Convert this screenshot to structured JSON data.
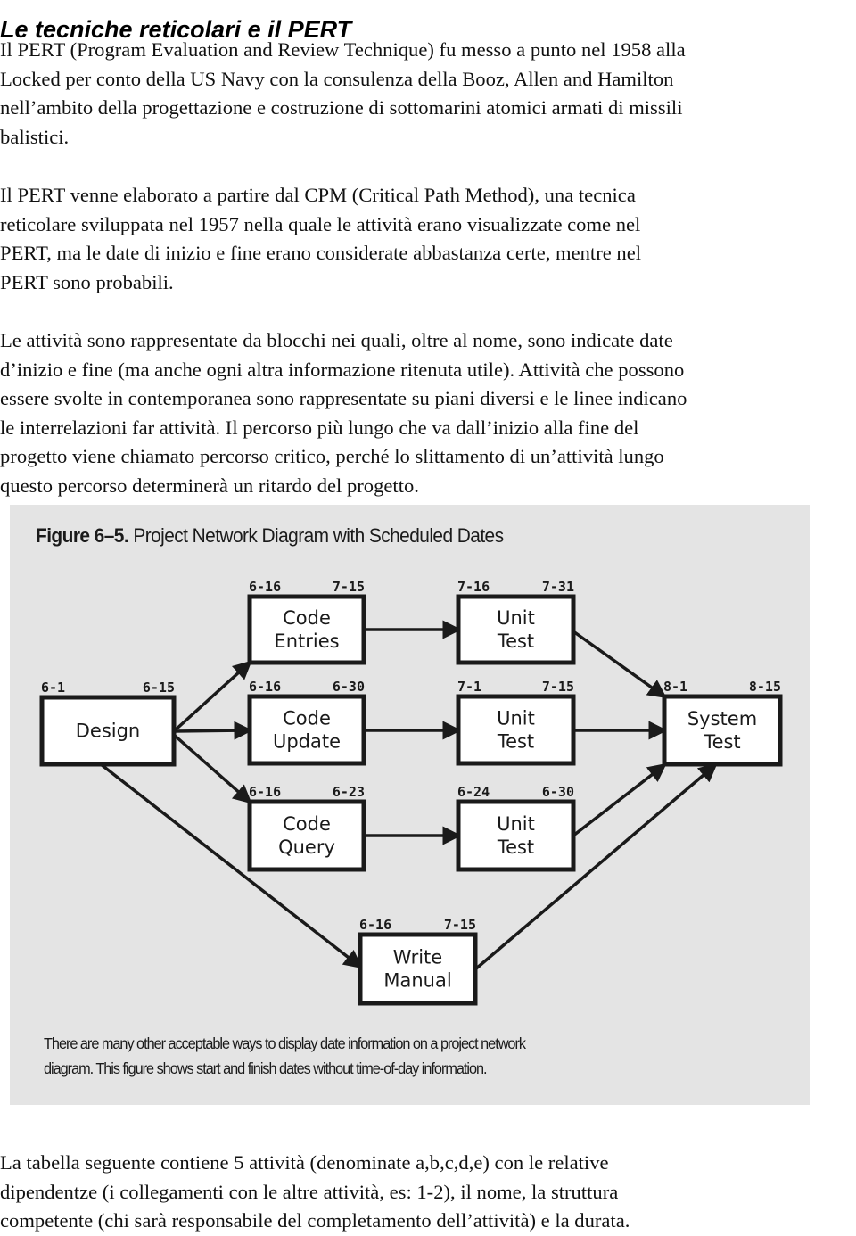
{
  "page": {
    "title": "Le tecniche reticolari e il PERT",
    "paragraphs": [
      {
        "lines": [
          "Il PERT (Program Evaluation and Review Technique) fu messo a punto nel 1958 alla",
          "Locked per conto della US Navy con la consulenza della Booz, Allen and Hamilton",
          "nell’ambito della progettazione e costruzione di sottomarini atomici armati di missili",
          "balistici."
        ]
      },
      {
        "lines": [
          "Il PERT venne elaborato a partire dal CPM (Critical Path Method), una tecnica",
          "reticolare sviluppata nel 1957 nella quale le attività erano visualizzate come nel",
          "PERT, ma le date di inizio e fine erano considerate abbastanza certe, mentre nel",
          "PERT sono probabili."
        ]
      },
      {
        "lines": [
          "Le attività sono rappresentate da blocchi nei quali, oltre al nome, sono indicate date",
          "d’inizio e fine (ma anche ogni altra informazione ritenuta utile). Attività che possono",
          "essere svolte in contemporanea sono rappresentate su piani diversi e le linee indicano",
          "le interrelazioni far attività. Il percorso più lungo che va dall’inizio alla fine del",
          "progetto viene chiamato percorso critico, perché lo slittamento di un’attività lungo",
          "questo percorso determinerà un ritardo del progetto."
        ]
      },
      {
        "lines": [
          "La tabella seguente contiene 5 attività (denominate a,b,c,d,e) con le relative",
          "dipendentze (i collegamenti con le altre attività, es: 1-2), il nome, la struttura",
          "competente (chi sarà responsabile del completamento dell’attività) e la durata."
        ]
      }
    ]
  },
  "figure": {
    "title_prefix": "Figure 6–5.",
    "title_text": " Project Network Diagram with Scheduled Dates",
    "caption_lines": [
      "There are many other acceptable ways to display date information on a project network",
      "diagram. This figure shows start and finish dates without time-of-day information."
    ],
    "nodes": [
      {
        "id": "design",
        "lines": [
          "Design"
        ],
        "start": "6-1",
        "finish": "6-15"
      },
      {
        "id": "code-entries",
        "lines": [
          "Code",
          "Entries"
        ],
        "start": "6-16",
        "finish": "7-15"
      },
      {
        "id": "code-update",
        "lines": [
          "Code",
          "Update"
        ],
        "start": "6-16",
        "finish": "6-30"
      },
      {
        "id": "code-query",
        "lines": [
          "Code",
          "Query"
        ],
        "start": "6-16",
        "finish": "6-23"
      },
      {
        "id": "unit-test-1",
        "lines": [
          "Unit",
          "Test"
        ],
        "start": "7-16",
        "finish": "7-31"
      },
      {
        "id": "unit-test-2",
        "lines": [
          "Unit",
          "Test"
        ],
        "start": "7-1",
        "finish": "7-15"
      },
      {
        "id": "unit-test-3",
        "lines": [
          "Unit",
          "Test"
        ],
        "start": "6-24",
        "finish": "6-30"
      },
      {
        "id": "system-test",
        "lines": [
          "System",
          "Test"
        ],
        "start": "8-1",
        "finish": "8-15"
      },
      {
        "id": "write-manual",
        "lines": [
          "Write",
          "Manual"
        ],
        "start": "6-16",
        "finish": "7-15"
      }
    ],
    "edges": [
      {
        "from": "design",
        "to": "code-entries"
      },
      {
        "from": "design",
        "to": "code-update"
      },
      {
        "from": "design",
        "to": "code-query"
      },
      {
        "from": "design",
        "to": "write-manual"
      },
      {
        "from": "code-entries",
        "to": "unit-test-1"
      },
      {
        "from": "code-update",
        "to": "unit-test-2"
      },
      {
        "from": "code-query",
        "to": "unit-test-3"
      },
      {
        "from": "unit-test-1",
        "to": "system-test"
      },
      {
        "from": "unit-test-2",
        "to": "system-test"
      },
      {
        "from": "unit-test-3",
        "to": "system-test"
      },
      {
        "from": "write-manual",
        "to": "system-test"
      }
    ],
    "colors": {
      "background": "#e4e4e4",
      "box_fill": "#ffffff",
      "stroke": "#1a1a1a"
    }
  }
}
